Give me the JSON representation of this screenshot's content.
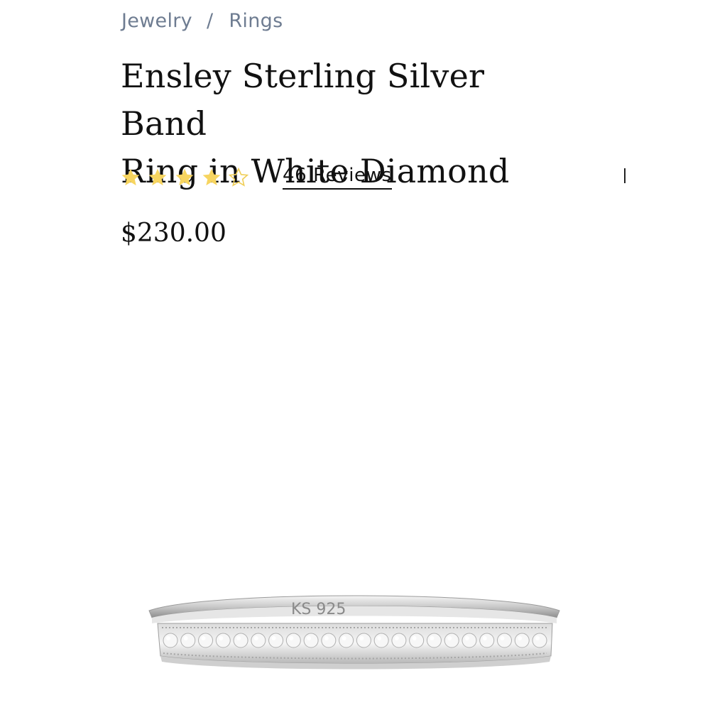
{
  "breadcrumb": {
    "items": [
      {
        "label": "Jewelry"
      },
      {
        "label": "Rings"
      }
    ],
    "separator": "/"
  },
  "product": {
    "title_line1": "Ensley Sterling Silver Band",
    "title_line2": "Ring in White Diamond",
    "rating": 4,
    "rating_max": 5,
    "reviews_label": "46 Reviews",
    "price": "$230.00",
    "engraving": "KS 925"
  },
  "colors": {
    "star_filled": "#f7d560",
    "star_outline": "#f0cf5a",
    "text": "#111111",
    "breadcrumb": "#6e7c91"
  }
}
